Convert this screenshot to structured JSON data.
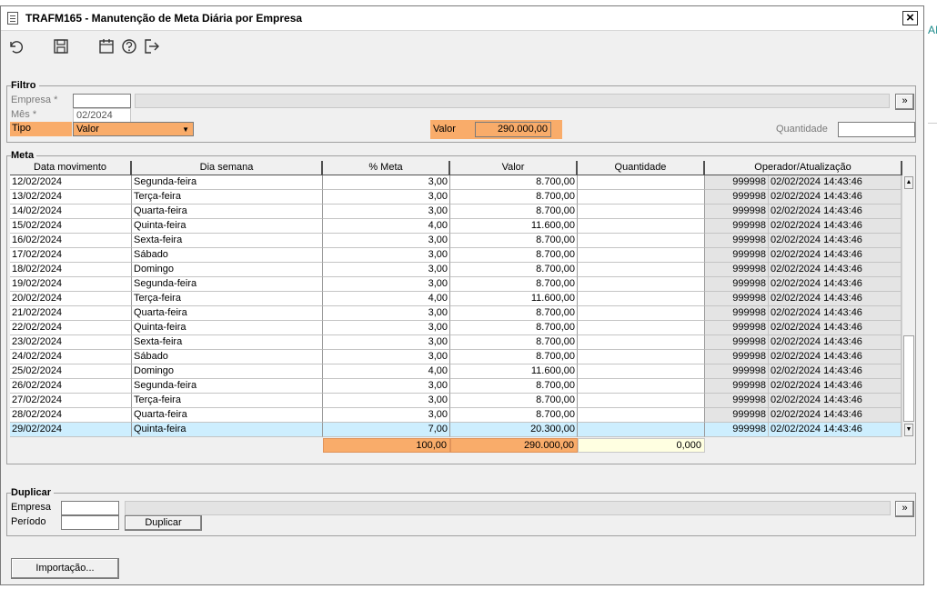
{
  "window": {
    "title": "TRAFM165 - Manutenção de Meta Diária por Empresa"
  },
  "background": {
    "partial_text": "AI"
  },
  "toolbar": {
    "icons": [
      "undo-icon",
      "save-icon",
      "calendar-icon",
      "help-icon",
      "exit-icon"
    ]
  },
  "filtro": {
    "label": "Filtro",
    "empresa_label": "Empresa *",
    "mes_label": "Mês *",
    "mes_value": "02/2024",
    "tipo_label": "Tipo",
    "tipo_value": "Valor",
    "valor_label": "Valor",
    "valor_value": "290.000,00",
    "quantidade_label": "Quantidade",
    "quantidade_value": "",
    "search_button": "»"
  },
  "meta": {
    "label": "Meta",
    "columns": [
      "Data movimento",
      "Dia semana",
      "% Meta",
      "Valor",
      "Quantidade",
      "Operador/Atualização"
    ],
    "rows": [
      {
        "data": "12/02/2024",
        "dia": "Segunda-feira",
        "pct": "3,00",
        "valor": "8.700,00",
        "qtd": "",
        "op": "999998",
        "upd": "02/02/2024 14:43:46"
      },
      {
        "data": "13/02/2024",
        "dia": "Terça-feira",
        "pct": "3,00",
        "valor": "8.700,00",
        "qtd": "",
        "op": "999998",
        "upd": "02/02/2024 14:43:46"
      },
      {
        "data": "14/02/2024",
        "dia": "Quarta-feira",
        "pct": "3,00",
        "valor": "8.700,00",
        "qtd": "",
        "op": "999998",
        "upd": "02/02/2024 14:43:46"
      },
      {
        "data": "15/02/2024",
        "dia": "Quinta-feira",
        "pct": "4,00",
        "valor": "11.600,00",
        "qtd": "",
        "op": "999998",
        "upd": "02/02/2024 14:43:46"
      },
      {
        "data": "16/02/2024",
        "dia": "Sexta-feira",
        "pct": "3,00",
        "valor": "8.700,00",
        "qtd": "",
        "op": "999998",
        "upd": "02/02/2024 14:43:46"
      },
      {
        "data": "17/02/2024",
        "dia": "Sábado",
        "pct": "3,00",
        "valor": "8.700,00",
        "qtd": "",
        "op": "999998",
        "upd": "02/02/2024 14:43:46"
      },
      {
        "data": "18/02/2024",
        "dia": "Domingo",
        "pct": "3,00",
        "valor": "8.700,00",
        "qtd": "",
        "op": "999998",
        "upd": "02/02/2024 14:43:46"
      },
      {
        "data": "19/02/2024",
        "dia": "Segunda-feira",
        "pct": "3,00",
        "valor": "8.700,00",
        "qtd": "",
        "op": "999998",
        "upd": "02/02/2024 14:43:46"
      },
      {
        "data": "20/02/2024",
        "dia": "Terça-feira",
        "pct": "4,00",
        "valor": "11.600,00",
        "qtd": "",
        "op": "999998",
        "upd": "02/02/2024 14:43:46"
      },
      {
        "data": "21/02/2024",
        "dia": "Quarta-feira",
        "pct": "3,00",
        "valor": "8.700,00",
        "qtd": "",
        "op": "999998",
        "upd": "02/02/2024 14:43:46"
      },
      {
        "data": "22/02/2024",
        "dia": "Quinta-feira",
        "pct": "3,00",
        "valor": "8.700,00",
        "qtd": "",
        "op": "999998",
        "upd": "02/02/2024 14:43:46"
      },
      {
        "data": "23/02/2024",
        "dia": "Sexta-feira",
        "pct": "3,00",
        "valor": "8.700,00",
        "qtd": "",
        "op": "999998",
        "upd": "02/02/2024 14:43:46"
      },
      {
        "data": "24/02/2024",
        "dia": "Sábado",
        "pct": "3,00",
        "valor": "8.700,00",
        "qtd": "",
        "op": "999998",
        "upd": "02/02/2024 14:43:46"
      },
      {
        "data": "25/02/2024",
        "dia": "Domingo",
        "pct": "4,00",
        "valor": "11.600,00",
        "qtd": "",
        "op": "999998",
        "upd": "02/02/2024 14:43:46"
      },
      {
        "data": "26/02/2024",
        "dia": "Segunda-feira",
        "pct": "3,00",
        "valor": "8.700,00",
        "qtd": "",
        "op": "999998",
        "upd": "02/02/2024 14:43:46"
      },
      {
        "data": "27/02/2024",
        "dia": "Terça-feira",
        "pct": "3,00",
        "valor": "8.700,00",
        "qtd": "",
        "op": "999998",
        "upd": "02/02/2024 14:43:46"
      },
      {
        "data": "28/02/2024",
        "dia": "Quarta-feira",
        "pct": "3,00",
        "valor": "8.700,00",
        "qtd": "",
        "op": "999998",
        "upd": "02/02/2024 14:43:46"
      },
      {
        "data": "29/02/2024",
        "dia": "Quinta-feira",
        "pct": "7,00",
        "valor": "20.300,00",
        "qtd": "",
        "op": "999998",
        "upd": "02/02/2024 14:43:46"
      }
    ],
    "selected_row": 17,
    "totals": {
      "pct": "100,00",
      "valor": "290.000,00",
      "qtd": "0,000"
    }
  },
  "duplicar": {
    "label": "Duplicar",
    "empresa_label": "Empresa",
    "periodo_label": "Período",
    "button": "Duplicar",
    "search_button": "»"
  },
  "importacao_button": "Importação...",
  "colors": {
    "orange": "#f9ac6a",
    "selected_row": "#cdeefe",
    "total_qtd_bg": "#ffffe1"
  }
}
